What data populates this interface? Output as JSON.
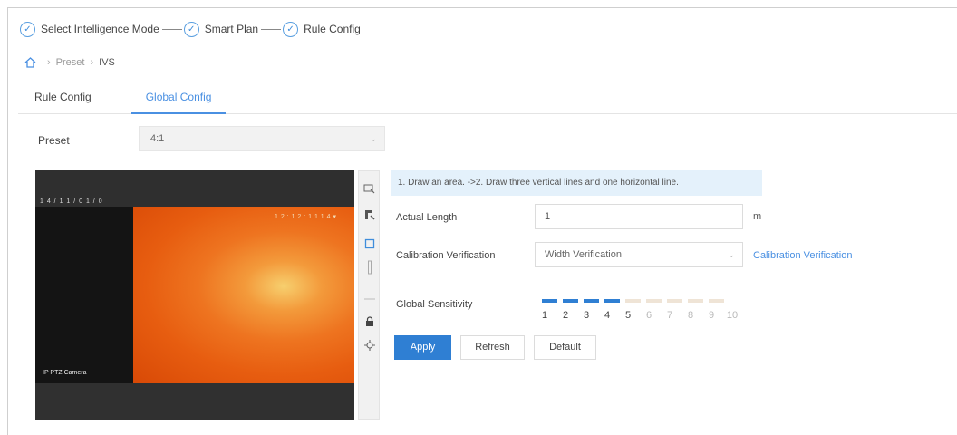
{
  "wizard": {
    "steps": [
      {
        "label": "Select Intelligence Mode"
      },
      {
        "label": "Smart Plan"
      },
      {
        "label": "Rule Config"
      }
    ]
  },
  "breadcrumb": {
    "items": [
      "Preset",
      "IVS"
    ]
  },
  "tabs": [
    {
      "label": "Rule Config",
      "active": false
    },
    {
      "label": "Global Config",
      "active": true
    }
  ],
  "preset": {
    "label": "Preset",
    "value": "4:1"
  },
  "video": {
    "osd_left": "1 4 / 1 1 / 0 1 / 0",
    "osd_right": "1 2 : 1 2 : 1 1 1 4 ▾",
    "camera_name": "IP PTZ Camera"
  },
  "toolbar": {
    "tools": [
      "draw-area-icon",
      "draw-line-icon",
      "draw-rect-icon",
      "vertical-line-icon",
      "horizontal-line-icon",
      "lock-icon",
      "locate-icon"
    ]
  },
  "config": {
    "hint": "1. Draw an area. ->2. Draw three vertical lines and one horizontal line.",
    "actual_length": {
      "label": "Actual Length",
      "value": "1",
      "unit": "m"
    },
    "calibration": {
      "label": "Calibration Verification",
      "value": "Width Verification",
      "link": "Calibration Verification"
    },
    "sensitivity": {
      "label": "Global Sensitivity",
      "value": 5,
      "levels": [
        "1",
        "2",
        "3",
        "4",
        "5",
        "6",
        "7",
        "8",
        "9",
        "10"
      ]
    }
  },
  "buttons": {
    "apply": "Apply",
    "refresh": "Refresh",
    "default": "Default"
  },
  "colors": {
    "accent": "#2f7fd3",
    "link": "#4a90e2",
    "hint_bg": "#e4f1fb"
  }
}
